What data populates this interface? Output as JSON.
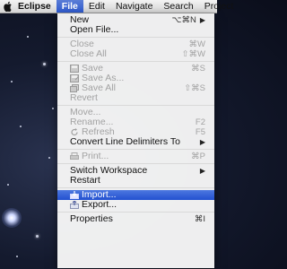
{
  "menubar": {
    "app": "Eclipse",
    "items": [
      "File",
      "Edit",
      "Navigate",
      "Search",
      "Project"
    ]
  },
  "menu": {
    "items": [
      {
        "label": "New",
        "shortcut": "⌥⌘N",
        "submenu": true
      },
      {
        "label": "Open File..."
      },
      {
        "separator": true
      },
      {
        "label": "Close",
        "shortcut": "⌘W",
        "disabled": true
      },
      {
        "label": "Close All",
        "shortcut": "⇧⌘W",
        "disabled": true
      },
      {
        "separator": true
      },
      {
        "label": "Save",
        "shortcut": "⌘S",
        "disabled": true,
        "icon": "save-icon"
      },
      {
        "label": "Save As...",
        "disabled": true,
        "icon": "save-as-icon"
      },
      {
        "label": "Save All",
        "shortcut": "⇧⌘S",
        "disabled": true,
        "icon": "save-all-icon"
      },
      {
        "label": "Revert",
        "disabled": true
      },
      {
        "separator": true
      },
      {
        "label": "Move...",
        "disabled": true
      },
      {
        "label": "Rename...",
        "shortcut": "F2",
        "disabled": true
      },
      {
        "label": "Refresh",
        "shortcut": "F5",
        "disabled": true,
        "icon": "refresh-icon"
      },
      {
        "label": "Convert Line Delimiters To",
        "submenu": true
      },
      {
        "separator": true
      },
      {
        "label": "Print...",
        "shortcut": "⌘P",
        "disabled": true,
        "icon": "print-icon"
      },
      {
        "separator": true
      },
      {
        "label": "Switch Workspace",
        "submenu": true
      },
      {
        "label": "Restart"
      },
      {
        "separator": true
      },
      {
        "label": "Import...",
        "highlighted": true,
        "icon": "import-icon"
      },
      {
        "label": "Export...",
        "icon": "export-icon"
      },
      {
        "separator": true
      },
      {
        "label": "Properties",
        "shortcut": "⌘I"
      }
    ]
  },
  "colors": {
    "highlight": "#2f5bd0",
    "disabled_text": "#a2a2a2"
  }
}
